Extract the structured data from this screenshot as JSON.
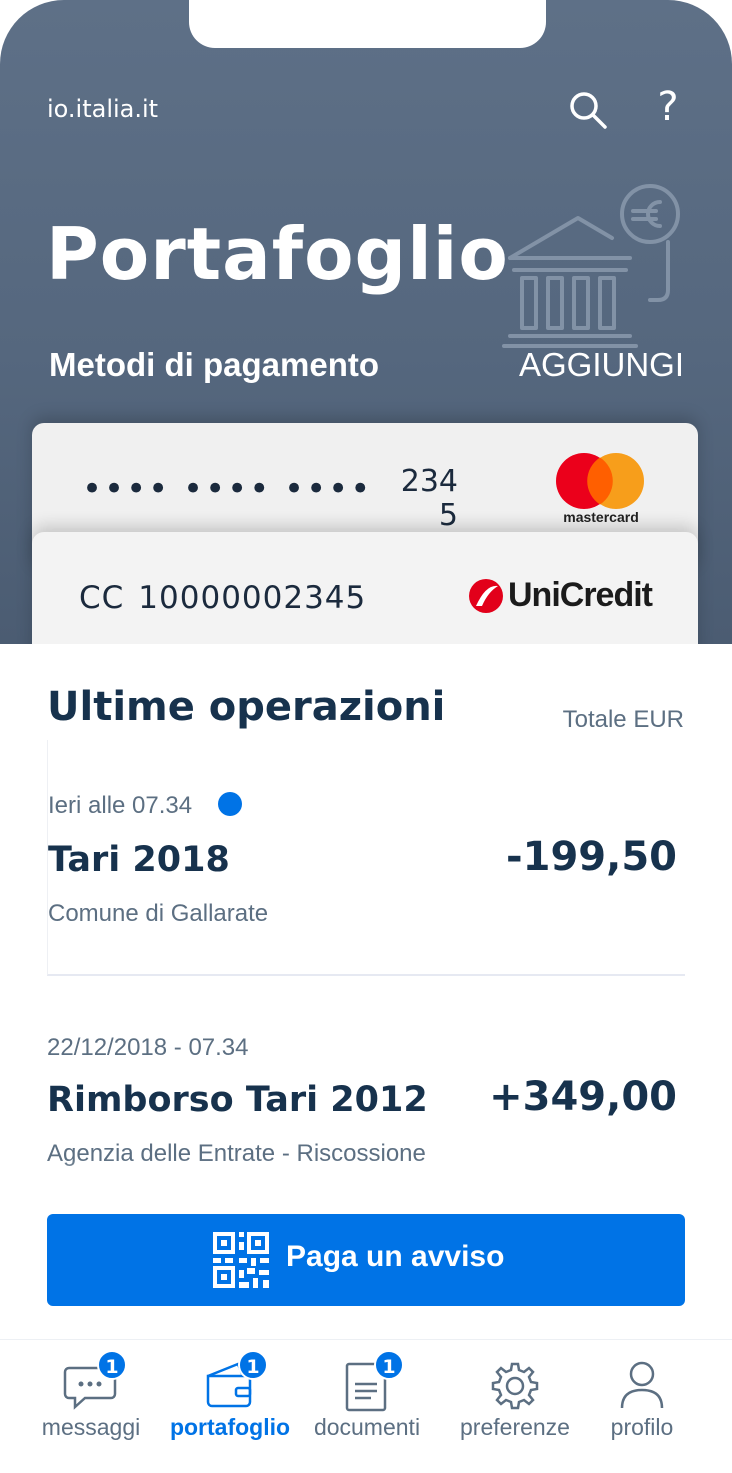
{
  "header": {
    "site": "io.italia.it",
    "help": "?",
    "title": "Portafoglio",
    "subtitle": "Metodi di pagamento",
    "add_label": "AGGIUNGI"
  },
  "cards": {
    "card1": {
      "masked": "•••• •••• ••••",
      "last_digits": "2345",
      "brand": "mastercard"
    },
    "card2": {
      "type_label": "CC",
      "number": "10000002345",
      "bank": "UniCredit"
    }
  },
  "operations": {
    "title": "Ultime operazioni",
    "total_label": "Totale EUR",
    "items": [
      {
        "date": "Ieri alle 07.34",
        "title": "Tari 2018",
        "amount": "-199,50",
        "subtitle": "Comune di Gallarate",
        "unread": true
      },
      {
        "date": "22/12/2018 - 07.34",
        "title": "Rimborso Tari 2012",
        "amount": "+349,00",
        "subtitle": "Agenzia delle Entrate - Riscossione",
        "unread": false
      }
    ]
  },
  "pay_button": {
    "label": "Paga un avviso",
    "icon": "qr-code-icon"
  },
  "tabbar": {
    "active": "portafoglio",
    "accent": "#0073e6",
    "tabs": [
      {
        "label": "messaggi",
        "icon": "message-icon",
        "badge": "1"
      },
      {
        "label": "portafoglio",
        "icon": "wallet-icon",
        "badge": "1"
      },
      {
        "label": "documenti",
        "icon": "document-icon",
        "badge": "1"
      },
      {
        "label": "preferenze",
        "icon": "gear-icon",
        "badge": ""
      },
      {
        "label": "profilo",
        "icon": "user-icon",
        "badge": ""
      }
    ]
  },
  "colors": {
    "header_bg": "#5e7087",
    "primary": "#0073e6",
    "text_dark": "#17324d",
    "text_muted": "#5c6f82"
  }
}
